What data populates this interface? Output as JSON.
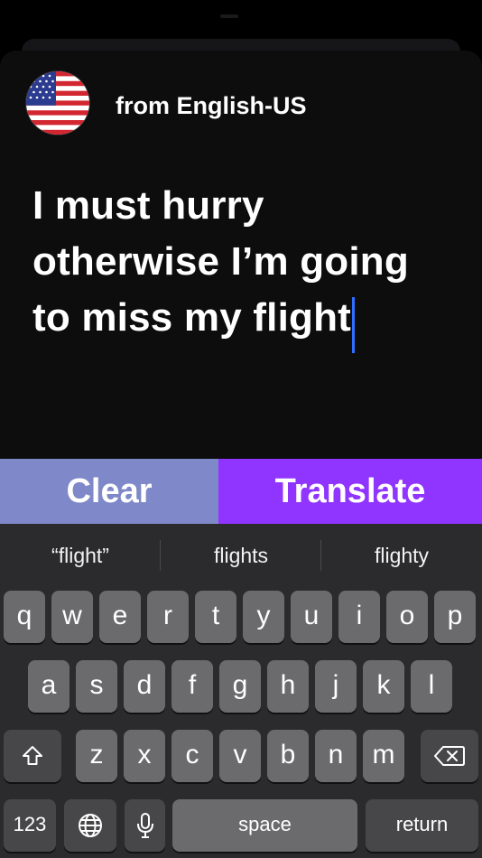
{
  "header": {
    "from_label": "from English-US"
  },
  "flag_icon": "us-flag-icon",
  "input": {
    "text": "I must hurry otherwise I’m going to miss my flight"
  },
  "actions": {
    "clear_label": "Clear",
    "translate_label": "Translate"
  },
  "colors": {
    "clear": "#7f88c8",
    "translate": "#9034ff",
    "caret": "#2f6fff"
  },
  "keyboard": {
    "suggestions": [
      "“flight”",
      "flights",
      "flighty"
    ],
    "row1": [
      "q",
      "w",
      "e",
      "r",
      "t",
      "y",
      "u",
      "i",
      "o",
      "p"
    ],
    "row2": [
      "a",
      "s",
      "d",
      "f",
      "g",
      "h",
      "j",
      "k",
      "l"
    ],
    "row3": [
      "z",
      "x",
      "c",
      "v",
      "b",
      "n",
      "m"
    ],
    "numbers_label": "123",
    "space_label": "space",
    "return_label": "return",
    "shift_icon": "shift-icon",
    "delete_icon": "delete-icon",
    "globe_icon": "globe-icon",
    "mic_icon": "microphone-icon"
  }
}
